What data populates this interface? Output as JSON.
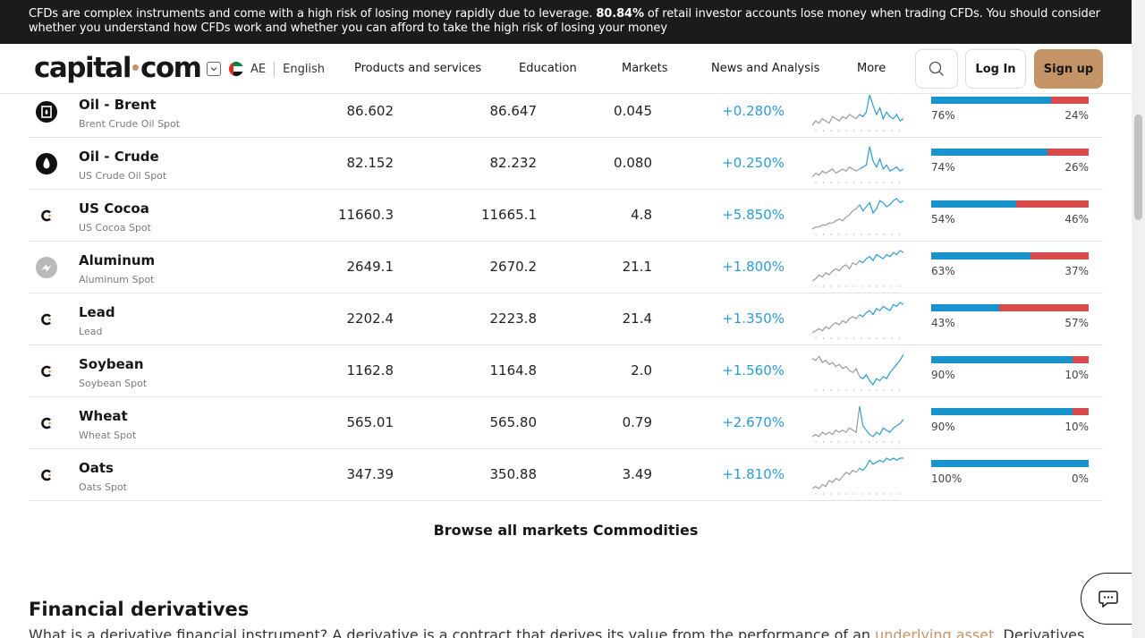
{
  "risk_banner": {
    "text_before": "CFDs are complex instruments and come with a high risk of losing money rapidly due to leverage. ",
    "bold_percent": "80.84%",
    "text_after": " of retail investor accounts lose money when trading CFDs. You should consider whether you understand how CFDs work and whether you can afford to take the high risk of losing your money"
  },
  "header": {
    "logo_left": "capital",
    "logo_right": "com",
    "country_code": "AE",
    "language": "English",
    "nav": [
      "Products and services",
      "Education",
      "Markets",
      "News and Analysis",
      "More"
    ],
    "login": "Log In",
    "signup": "Sign up"
  },
  "colors": {
    "accent": "#c49466",
    "change_positive": "#2e9bd3",
    "buy_bar": "#1894cc",
    "sell_bar": "#d94a4a"
  },
  "markets": [
    {
      "name": "Oil - Brent",
      "sub": "Brent Crude Oil Spot",
      "sell": "86.602",
      "buy": "86.647",
      "spread": "0.045",
      "change": "+0.280%",
      "buy_pct": 76,
      "buy_label": "76%",
      "sell_label": "24%",
      "icon": "oil-drop-square-icon"
    },
    {
      "name": "Oil - Crude",
      "sub": "US Crude Oil Spot",
      "sell": "82.152",
      "buy": "82.232",
      "spread": "0.080",
      "change": "+0.250%",
      "buy_pct": 74,
      "buy_label": "74%",
      "sell_label": "26%",
      "icon": "oil-drop-icon"
    },
    {
      "name": "US Cocoa",
      "sub": "US Cocoa Spot",
      "sell": "11660.3",
      "buy": "11665.1",
      "spread": "4.8",
      "change": "+5.850%",
      "buy_pct": 54,
      "buy_label": "54%",
      "sell_label": "46%",
      "icon": "capital-c-icon"
    },
    {
      "name": "Aluminum",
      "sub": "Aluminum Spot",
      "sell": "2649.1",
      "buy": "2670.2",
      "spread": "21.1",
      "change": "+1.800%",
      "buy_pct": 63,
      "buy_label": "63%",
      "sell_label": "37%",
      "icon": "aluminum-icon"
    },
    {
      "name": "Lead",
      "sub": "Lead",
      "sell": "2202.4",
      "buy": "2223.8",
      "spread": "21.4",
      "change": "+1.350%",
      "buy_pct": 43,
      "buy_label": "43%",
      "sell_label": "57%",
      "icon": "capital-c-icon"
    },
    {
      "name": "Soybean",
      "sub": "Soybean Spot",
      "sell": "1162.8",
      "buy": "1164.8",
      "spread": "2.0",
      "change": "+1.560%",
      "buy_pct": 90,
      "buy_label": "90%",
      "sell_label": "10%",
      "icon": "capital-c-icon"
    },
    {
      "name": "Wheat",
      "sub": "Wheat Spot",
      "sell": "565.01",
      "buy": "565.80",
      "spread": "0.79",
      "change": "+2.670%",
      "buy_pct": 90,
      "buy_label": "90%",
      "sell_label": "10%",
      "icon": "capital-c-icon"
    },
    {
      "name": "Oats",
      "sub": "Oats Spot",
      "sell": "347.39",
      "buy": "350.88",
      "spread": "3.49",
      "change": "+1.810%",
      "buy_pct": 100,
      "buy_label": "100%",
      "sell_label": "0%",
      "icon": "capital-c-icon"
    }
  ],
  "browse_link": "Browse all markets Commodities",
  "section": {
    "title": "Financial derivatives",
    "para_before": "What is a derivative financial instrument? A derivative is a contract that derives its value from the performance of an ",
    "para_link": "underlying asset",
    "para_after": ". Derivatives"
  }
}
